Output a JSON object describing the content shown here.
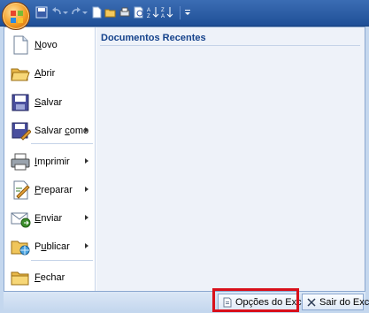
{
  "menu": {
    "items": [
      {
        "label": "Novo",
        "mnemonic": "N",
        "icon": "new-document-icon",
        "submenu": false
      },
      {
        "label": "Abrir",
        "mnemonic": "A",
        "icon": "open-folder-icon",
        "submenu": false
      },
      {
        "label": "Salvar",
        "mnemonic": "S",
        "icon": "save-disk-icon",
        "submenu": false
      },
      {
        "label": "Salvar como",
        "mnemonic": "c",
        "icon": "save-as-icon",
        "submenu": true
      },
      {
        "label": "Imprimir",
        "mnemonic": "I",
        "icon": "printer-icon",
        "submenu": true
      },
      {
        "label": "Preparar",
        "mnemonic": "P",
        "icon": "prepare-icon",
        "submenu": true
      },
      {
        "label": "Enviar",
        "mnemonic": "E",
        "icon": "send-icon",
        "submenu": true
      },
      {
        "label": "Publicar",
        "mnemonic": "u",
        "icon": "publish-icon",
        "submenu": true
      },
      {
        "label": "Fechar",
        "mnemonic": "F",
        "icon": "close-folder-icon",
        "submenu": false
      }
    ]
  },
  "recent": {
    "title": "Documentos Recentes"
  },
  "bottom": {
    "options_label": "Opções do Excel",
    "exit_label": "Sair do Excel"
  },
  "colors": {
    "title_bar": "#2b5ca5",
    "highlight": "#d8101b",
    "recent_title": "#15428b"
  }
}
